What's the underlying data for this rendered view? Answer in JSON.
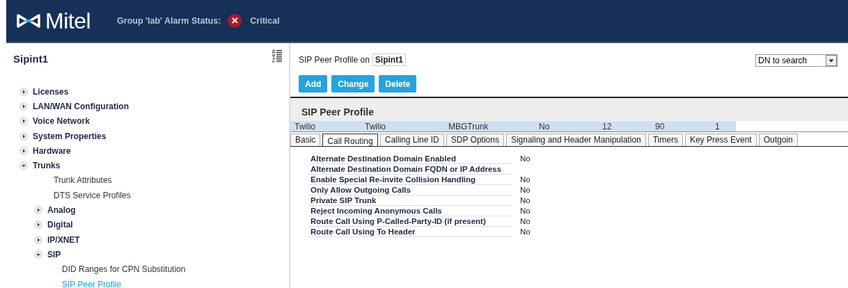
{
  "header": {
    "brand": "Mitel",
    "alarm_label": "Group 'lab' Alarm Status:",
    "alarm_status": "Critical",
    "alarm_icon": "×"
  },
  "sidebar": {
    "title": "Sipint1",
    "items": [
      {
        "label": "Licenses",
        "expanded": false,
        "selected": false
      },
      {
        "label": "LAN/WAN Configuration",
        "expanded": false,
        "selected": false
      },
      {
        "label": "Voice Network",
        "expanded": false,
        "selected": false
      },
      {
        "label": "System Properties",
        "expanded": false,
        "selected": false
      },
      {
        "label": "Hardware",
        "expanded": false,
        "selected": false
      },
      {
        "label": "Trunks",
        "expanded": true,
        "selected": false,
        "children": [
          {
            "label": "Trunk Attributes",
            "selected": false
          },
          {
            "label": "DTS Service Profiles",
            "selected": false
          },
          {
            "label": "Analog",
            "expanded": false,
            "selected": false
          },
          {
            "label": "Digital",
            "expanded": false,
            "selected": false
          },
          {
            "label": "IP/XNET",
            "expanded": false,
            "selected": false
          },
          {
            "label": "SIP",
            "expanded": true,
            "selected": false,
            "children": [
              {
                "label": "DID Ranges for CPN Substitution",
                "selected": false
              },
              {
                "label": "SIP Peer Profile",
                "selected": true
              }
            ]
          }
        ]
      }
    ]
  },
  "main": {
    "heading_prefix": "SIP Peer Profile on",
    "heading_system": "Sipint1",
    "search": {
      "value": "DN to search"
    },
    "buttons": [
      "Add",
      "Change",
      "Delete"
    ],
    "section_title": "SIP Peer Profile",
    "summary_row": [
      "Twilio",
      "Twilio",
      "MBGTrunk",
      "No",
      "12",
      "90",
      "1"
    ],
    "tabs": [
      {
        "label": "Basic",
        "selected": false
      },
      {
        "label": "Call Routing",
        "selected": true
      },
      {
        "label": "Calling Line ID",
        "selected": false
      },
      {
        "label": "SDP Options",
        "selected": false
      },
      {
        "label": "Signaling and Header Manipulation",
        "selected": false
      },
      {
        "label": "Timers",
        "selected": false
      },
      {
        "label": "Key Press Event",
        "selected": false
      },
      {
        "label": "Outgoin",
        "selected": false
      }
    ],
    "properties": [
      {
        "label": "Alternate Destination Domain Enabled",
        "value": "No"
      },
      {
        "label": "Alternate Destination Domain FQDN or IP Address"
      },
      {
        "label": "Enable Special Re-invite Collision Handling",
        "value": "No"
      },
      {
        "label": "Only Allow Outgoing Calls",
        "value": "No"
      },
      {
        "label": "Private SIP Trunk",
        "value": "No"
      },
      {
        "label": "Reject Incoming Anonymous Calls",
        "value": "No"
      },
      {
        "label": "Route Call Using P-Called-Party-ID (if present)",
        "value": "No"
      },
      {
        "label": "Route Call Using To Header",
        "value": "No"
      }
    ]
  }
}
